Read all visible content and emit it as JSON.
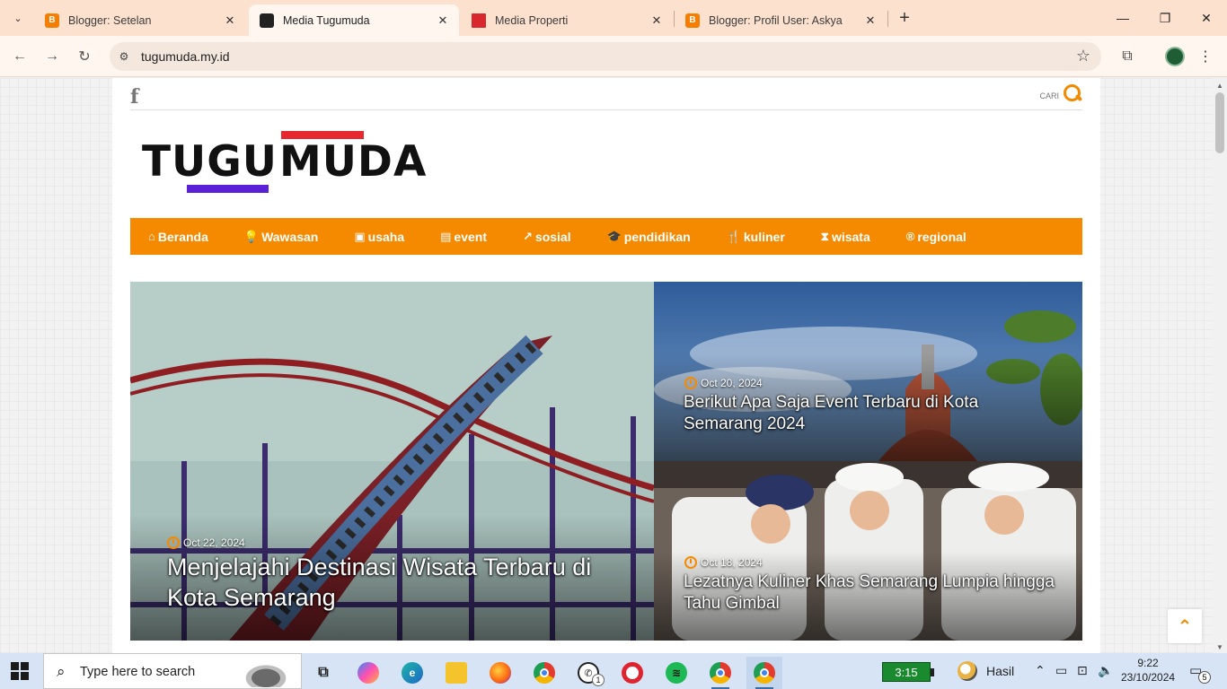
{
  "browser": {
    "tabs": [
      {
        "title": "Blogger: Setelan",
        "favicon_color": "#f57d00",
        "active": false
      },
      {
        "title": "Media Tugumuda",
        "favicon_color": "#222222",
        "active": true
      },
      {
        "title": "Media Properti",
        "favicon_color": "#d9272e",
        "active": false
      },
      {
        "title": "Blogger: Profil User: Askya",
        "favicon_color": "#f57d00",
        "active": false
      }
    ],
    "url": "tugumuda.my.id"
  },
  "site": {
    "search_label": "CARI",
    "logo_left": "TUGU",
    "logo_right": "MUDA",
    "nav": [
      {
        "label": "Beranda",
        "icon": "home-icon",
        "glyph": "⌂"
      },
      {
        "label": "Wawasan",
        "icon": "lightbulb-icon",
        "glyph": "💡"
      },
      {
        "label": "usaha",
        "icon": "briefcase-icon",
        "glyph": "▣"
      },
      {
        "label": "event",
        "icon": "calendar-icon",
        "glyph": "▤"
      },
      {
        "label": "sosial",
        "icon": "share-icon",
        "glyph": "↗"
      },
      {
        "label": "pendidikan",
        "icon": "graduation-cap-icon",
        "glyph": "🎓"
      },
      {
        "label": "kuliner",
        "icon": "cutlery-icon",
        "glyph": "🍴"
      },
      {
        "label": "wisata",
        "icon": "hourglass-icon",
        "glyph": "⧗"
      },
      {
        "label": "regional",
        "icon": "registered-icon",
        "glyph": "®"
      }
    ],
    "featured": {
      "date": "Oct 22, 2024",
      "title": "Menjelajahi Destinasi Wisata Terbaru di Kota Semarang"
    },
    "side_posts": [
      {
        "date": "Oct 20, 2024",
        "title": "Berikut Apa Saja Event Terbaru di Kota Semarang 2024"
      },
      {
        "date": "Oct 18, 2024",
        "title": "Lezatnya Kuliner Khas Semarang Lumpia hingga Tahu Gimbal"
      }
    ]
  },
  "taskbar": {
    "search_placeholder": "Type here to search",
    "whatsapp_badge": "1",
    "battery_time": "3:15",
    "weather_text": "Hasil",
    "time": "9:22",
    "date": "23/10/2024",
    "notification_count": "5"
  }
}
